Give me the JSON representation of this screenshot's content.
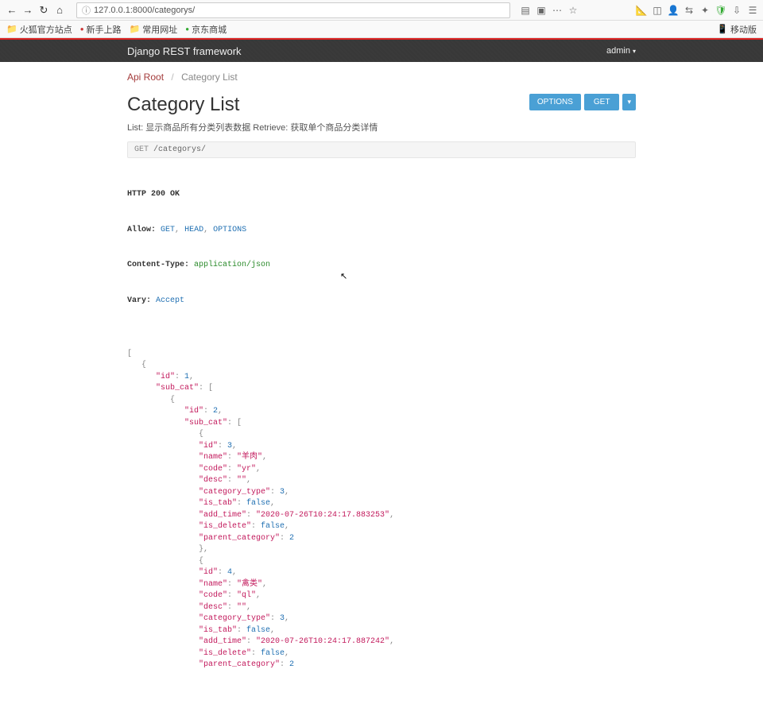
{
  "browser": {
    "url": "127.0.0.1:8000/categorys/",
    "bookmarks": [
      "火狐官方站点",
      "新手上路",
      "常用网址",
      "京东商城"
    ],
    "mobile_label": "移动版"
  },
  "header": {
    "brand": "Django REST framework",
    "user": "admin"
  },
  "breadcrumb": {
    "root": "Api Root",
    "current": "Category List"
  },
  "page": {
    "title": "Category List",
    "subtitle": "List: 显示商品所有分类列表数据 Retrieve: 获取单个商品分类详情",
    "options_btn": "OPTIONS",
    "get_btn": "GET"
  },
  "request": {
    "method": "GET",
    "path": "/categorys/"
  },
  "response": {
    "status_line": "HTTP 200 OK",
    "allow_label": "Allow:",
    "allow_methods": [
      "GET",
      "HEAD",
      "OPTIONS"
    ],
    "ctype_label": "Content-Type:",
    "ctype_value": "application/json",
    "vary_label": "Vary:",
    "vary_value": "Accept"
  },
  "json_tree": [
    {
      "id": 1,
      "sub_cat": [
        {
          "id": 2,
          "sub_cat": [
            {
              "id": 3,
              "name": "羊肉",
              "code": "yr",
              "desc": "",
              "category_type": 3,
              "is_tab": false,
              "add_time": "2020-07-26T10:24:17.883253",
              "is_delete": false,
              "parent_category": 2
            },
            {
              "id": 4,
              "name": "禽类",
              "code": "ql",
              "desc": "",
              "category_type": 3,
              "is_tab": false,
              "add_time": "2020-07-26T10:24:17.887242",
              "is_delete": false,
              "parent_category": 2
            }
          ]
        }
      ]
    }
  ]
}
